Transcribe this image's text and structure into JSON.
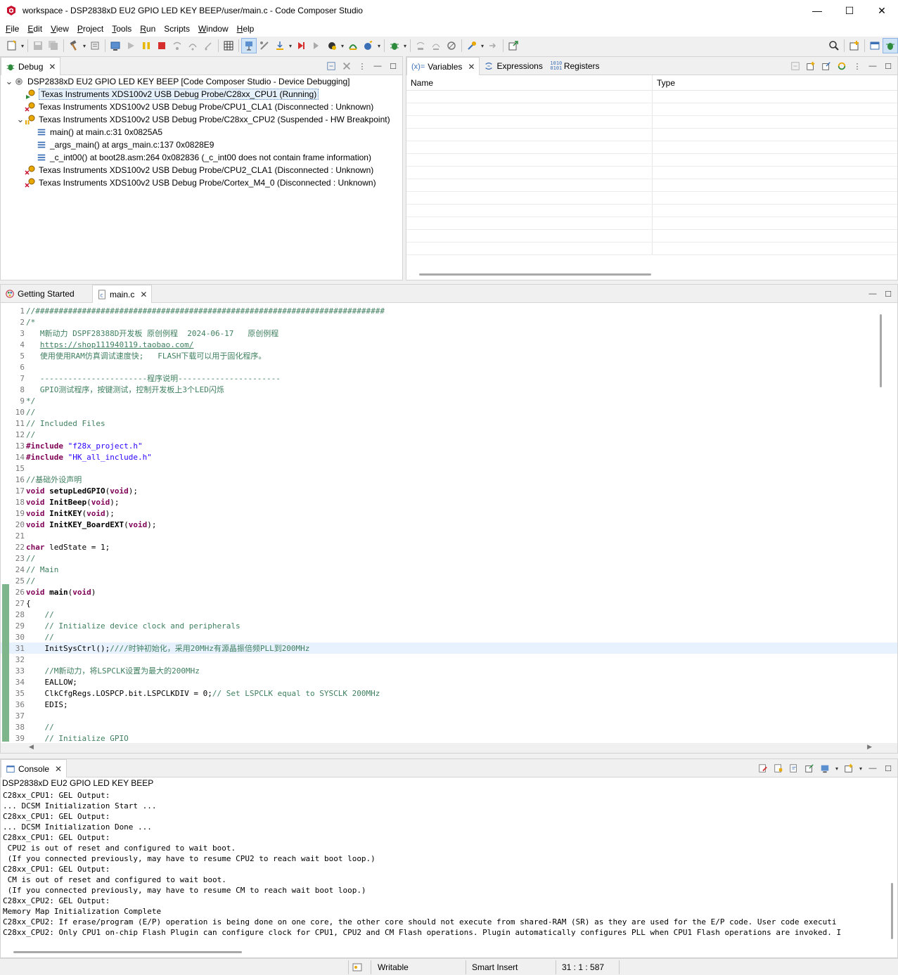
{
  "window": {
    "title": "workspace - DSP2838xD EU2 GPIO LED KEY BEEP/user/main.c - Code Composer Studio",
    "minimize": "—",
    "maximize": "☐",
    "close": "✕"
  },
  "menu": [
    {
      "u": "F",
      "rest": "ile"
    },
    {
      "u": "E",
      "rest": "dit"
    },
    {
      "u": "V",
      "rest": "iew"
    },
    {
      "u": "P",
      "rest": "roject"
    },
    {
      "u": "T",
      "rest": "ools"
    },
    {
      "u": "R",
      "rest": "un"
    },
    {
      "u": "",
      "rest": "Scripts"
    },
    {
      "u": "W",
      "rest": "indow"
    },
    {
      "u": "H",
      "rest": "elp"
    }
  ],
  "debug_view": {
    "tab_label": "Debug",
    "tree": [
      {
        "level": 0,
        "twisty": "v",
        "icon": "debug-session-icon",
        "text": "DSP2838xD EU2 GPIO LED KEY BEEP [Code Composer Studio - Device Debugging]"
      },
      {
        "level": 1,
        "twisty": "",
        "icon": "core-running-icon",
        "text": "Texas Instruments XDS100v2 USB Debug Probe/C28xx_CPU1 (Running)",
        "selected": true
      },
      {
        "level": 1,
        "twisty": "",
        "icon": "core-disconnected-icon",
        "text": "Texas Instruments XDS100v2 USB Debug Probe/CPU1_CLA1 (Disconnected : Unknown)"
      },
      {
        "level": 1,
        "twisty": "v",
        "icon": "core-suspended-icon",
        "text": "Texas Instruments XDS100v2 USB Debug Probe/C28xx_CPU2 (Suspended - HW Breakpoint)"
      },
      {
        "level": 2,
        "twisty": "",
        "icon": "stack-frame-icon",
        "text": "main() at main.c:31 0x0825A5"
      },
      {
        "level": 2,
        "twisty": "",
        "icon": "stack-frame-icon",
        "text": "_args_main() at args_main.c:137 0x0828E9"
      },
      {
        "level": 2,
        "twisty": "",
        "icon": "stack-frame-icon",
        "text": "_c_int00() at boot28.asm:264 0x082836  (_c_int00 does not contain frame information)"
      },
      {
        "level": 1,
        "twisty": "",
        "icon": "core-disconnected-icon",
        "text": "Texas Instruments XDS100v2 USB Debug Probe/CPU2_CLA1 (Disconnected : Unknown)"
      },
      {
        "level": 1,
        "twisty": "",
        "icon": "core-disconnected-icon",
        "text": "Texas Instruments XDS100v2 USB Debug Probe/Cortex_M4_0 (Disconnected : Unknown)"
      }
    ]
  },
  "variables_view": {
    "tabs": [
      {
        "label": "Variables",
        "prefix": "(x)="
      },
      {
        "label": "Expressions"
      },
      {
        "label": "Registers"
      }
    ],
    "col_name": "Name",
    "col_type": "Type"
  },
  "editor": {
    "tabs": [
      {
        "label": "Getting Started"
      },
      {
        "label": "main.c"
      }
    ],
    "current_line": 31,
    "lines": [
      [
        {
          "c": "cm",
          "t": "//###########################################################################"
        }
      ],
      [
        {
          "c": "cm",
          "t": "/*"
        }
      ],
      [
        {
          "c": "cm",
          "t": "   M新动力 DSPF28388D开发板 原创例程  2024-06-17   原创例程"
        }
      ],
      [
        {
          "c": "cm",
          "t": "   "
        },
        {
          "c": "url",
          "t": "https://shop111940119.taobao.com/"
        }
      ],
      [
        {
          "c": "cm",
          "t": "   使用使用RAM仿真调试速度快;   FLASH下载可以用于固化程序。"
        }
      ],
      [
        {
          "c": "cm",
          "t": ""
        }
      ],
      [
        {
          "c": "cm",
          "t": "   -----------------------程序说明----------------------"
        }
      ],
      [
        {
          "c": "cm",
          "t": "   GPIO测试程序，按键测试，控制开发板上3个LED闪烁"
        }
      ],
      [
        {
          "c": "cm",
          "t": "*/"
        }
      ],
      [
        {
          "c": "cm",
          "t": "//"
        }
      ],
      [
        {
          "c": "cm",
          "t": "// Included Files"
        }
      ],
      [
        {
          "c": "cm",
          "t": "//"
        }
      ],
      [
        {
          "c": "pp",
          "t": "#include "
        },
        {
          "c": "str",
          "t": "\"f28x_project.h\""
        }
      ],
      [
        {
          "c": "pp",
          "t": "#include "
        },
        {
          "c": "str",
          "t": "\"HK_all_include.h\""
        }
      ],
      [
        {
          "c": "",
          "t": ""
        }
      ],
      [
        {
          "c": "cm",
          "t": "//基础外设声明"
        }
      ],
      [
        {
          "c": "kw",
          "t": "void "
        },
        {
          "c": "fn",
          "t": "setupLedGPIO"
        },
        {
          "c": "",
          "t": "("
        },
        {
          "c": "kw",
          "t": "void"
        },
        {
          "c": "",
          "t": ");"
        }
      ],
      [
        {
          "c": "kw",
          "t": "void "
        },
        {
          "c": "fn",
          "t": "InitBeep"
        },
        {
          "c": "",
          "t": "("
        },
        {
          "c": "kw",
          "t": "void"
        },
        {
          "c": "",
          "t": ");"
        }
      ],
      [
        {
          "c": "kw",
          "t": "void "
        },
        {
          "c": "fn",
          "t": "InitKEY"
        },
        {
          "c": "",
          "t": "("
        },
        {
          "c": "kw",
          "t": "void"
        },
        {
          "c": "",
          "t": ");"
        }
      ],
      [
        {
          "c": "kw",
          "t": "void "
        },
        {
          "c": "fn",
          "t": "InitKEY_BoardEXT"
        },
        {
          "c": "",
          "t": "("
        },
        {
          "c": "kw",
          "t": "void"
        },
        {
          "c": "",
          "t": ");"
        }
      ],
      [
        {
          "c": "",
          "t": ""
        }
      ],
      [
        {
          "c": "kw",
          "t": "char "
        },
        {
          "c": "",
          "t": "ledState = 1;"
        }
      ],
      [
        {
          "c": "cm",
          "t": "//"
        }
      ],
      [
        {
          "c": "cm",
          "t": "// Main"
        }
      ],
      [
        {
          "c": "cm",
          "t": "//"
        }
      ],
      [
        {
          "c": "kw",
          "t": "void "
        },
        {
          "c": "fn",
          "t": "main"
        },
        {
          "c": "",
          "t": "("
        },
        {
          "c": "kw",
          "t": "void"
        },
        {
          "c": "",
          "t": ")"
        }
      ],
      [
        {
          "c": "",
          "t": "{"
        }
      ],
      [
        {
          "c": "cm",
          "t": "    //"
        }
      ],
      [
        {
          "c": "cm",
          "t": "    // Initialize device clock and peripherals"
        }
      ],
      [
        {
          "c": "cm",
          "t": "    //"
        }
      ],
      [
        {
          "c": "",
          "t": "    InitSysCtrl();"
        },
        {
          "c": "cm",
          "t": "////时钟初始化，采用20MHz有源晶振倍频PLL到200MHz"
        }
      ],
      [
        {
          "c": "",
          "t": ""
        }
      ],
      [
        {
          "c": "cm",
          "t": "    //M新动力，将LSPCLK设置为最大的200MHz"
        }
      ],
      [
        {
          "c": "",
          "t": "    EALLOW;"
        }
      ],
      [
        {
          "c": "",
          "t": "    ClkCfgRegs.LOSPCP.bit.LSPCLKDIV = 0;"
        },
        {
          "c": "cm",
          "t": "// Set LSPCLK equal to SYSCLK 200MHz"
        }
      ],
      [
        {
          "c": "",
          "t": "    EDIS;"
        }
      ],
      [
        {
          "c": "",
          "t": ""
        }
      ],
      [
        {
          "c": "cm",
          "t": "    //"
        }
      ],
      [
        {
          "c": "cm",
          "t": "    // Initialize GPIO"
        }
      ]
    ]
  },
  "console": {
    "tab_label": "Console",
    "header": "DSP2838xD EU2 GPIO LED KEY BEEP",
    "lines": [
      "C28xx_CPU1: GEL Output:",
      "... DCSM Initialization Start ...",
      "C28xx_CPU1: GEL Output:",
      "... DCSM Initialization Done ...",
      "C28xx_CPU1: GEL Output:",
      " CPU2 is out of reset and configured to wait boot.",
      " (If you connected previously, may have to resume CPU2 to reach wait boot loop.)",
      "C28xx_CPU1: GEL Output:",
      " CM is out of reset and configured to wait boot.",
      " (If you connected previously, may have to resume CM to reach wait boot loop.)",
      "C28xx_CPU2: GEL Output:",
      "Memory Map Initialization Complete",
      "C28xx_CPU2: If erase/program (E/P) operation is being done on one core, the other core should not execute from shared-RAM (SR) as they are used for the E/P code. User code executi",
      "C28xx_CPU2: Only CPU1 on-chip Flash Plugin can configure clock for CPU1, CPU2 and CM Flash operations. Plugin automatically configures PLL when CPU1 Flash operations are invoked. I"
    ]
  },
  "status": {
    "writable": "Writable",
    "insert_mode": "Smart Insert",
    "position": "31 : 1 : 587"
  }
}
